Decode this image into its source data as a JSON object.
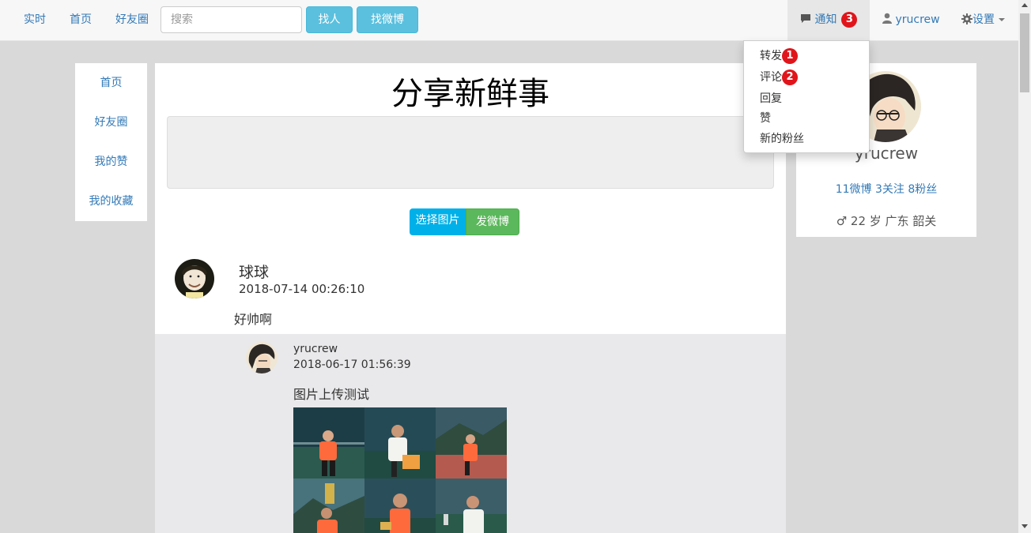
{
  "nav": {
    "realtime": "实时",
    "home": "首页",
    "friends": "好友圈",
    "search_placeholder": "搜索",
    "find_people": "找人",
    "find_weibo": "找微博",
    "notifications": "通知",
    "notification_count": "3",
    "username": "yrucrew",
    "settings": "设置"
  },
  "notification_menu": {
    "items": [
      {
        "label": "转发",
        "badge": "1"
      },
      {
        "label": "评论",
        "badge": "2"
      },
      {
        "label": "回复"
      },
      {
        "label": "赞"
      },
      {
        "label": "新的粉丝"
      }
    ]
  },
  "sidebar": {
    "items": [
      {
        "label": "首页"
      },
      {
        "label": "好友圈"
      },
      {
        "label": "我的赞"
      },
      {
        "label": "我的收藏"
      }
    ]
  },
  "composer": {
    "title": "分享新鲜事",
    "choose_image": "选择图片",
    "post_button": "发微博"
  },
  "post": {
    "user": "球球",
    "time": "2018-07-14 00:26:10",
    "content": "好帅啊",
    "repost": {
      "user": "yrucrew",
      "time": "2018-06-17 01:56:39",
      "content": "图片上传测试",
      "photo_count": 6
    }
  },
  "profile": {
    "name": "yrucrew",
    "stats": "11微博 3关注 8粉丝",
    "gender_icon": "male-icon",
    "info": "♂ 22 岁 广东 韶关"
  },
  "colors": {
    "link": "#337ab7",
    "info_button": "#5bc0de",
    "success_button": "#5cb85c",
    "badge": "#e0151b"
  }
}
